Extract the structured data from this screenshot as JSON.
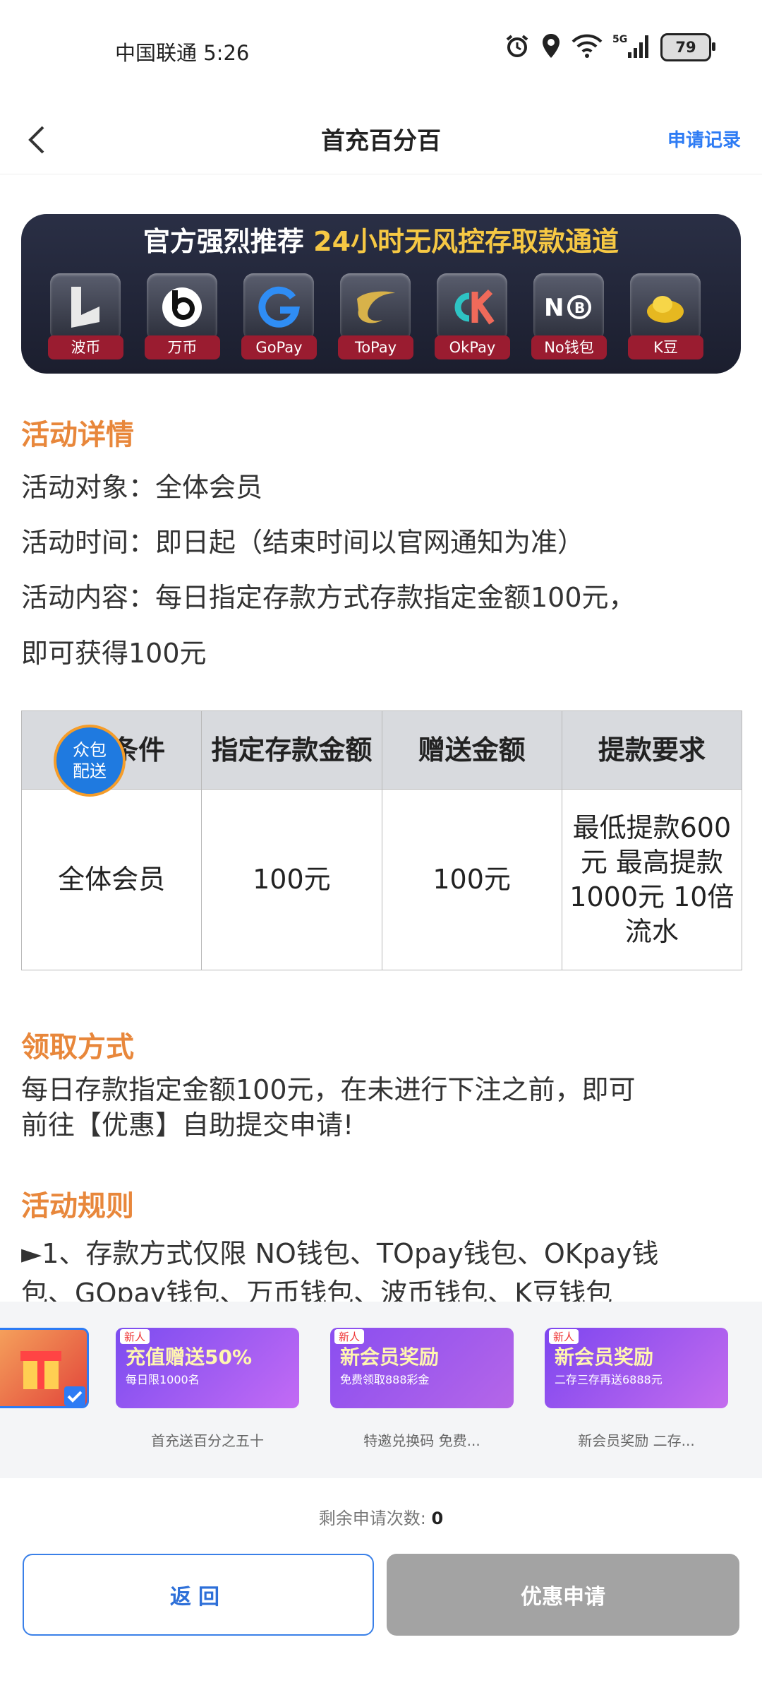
{
  "status_bar": {
    "carrier_time": "中国联通 5:26",
    "battery": "79",
    "network": "5G"
  },
  "header": {
    "title": "首充百分百",
    "record_link": "申请记录"
  },
  "banner": {
    "title_white": "官方强烈推荐",
    "title_yellow": "24小时无风控存取款通道",
    "payments": [
      {
        "label": "波币",
        "icon": "bobi-icon"
      },
      {
        "label": "万币",
        "icon": "wanbi-icon"
      },
      {
        "label": "GoPay",
        "icon": "gopay-icon"
      },
      {
        "label": "ToPay",
        "icon": "topay-icon"
      },
      {
        "label": "OkPay",
        "icon": "okpay-icon"
      },
      {
        "label": "No钱包",
        "icon": "nowallet-icon"
      },
      {
        "label": "K豆",
        "icon": "kdou-icon"
      }
    ]
  },
  "details": {
    "title": "活动详情",
    "target": "活动对象：全体会员",
    "time": "活动时间：即日起（结束时间以官网通知为准）",
    "content_line1": "活动内容：每日指定存款方式存款指定金额100元，",
    "content_line2": "即可获得100元"
  },
  "table": {
    "headers": [
      "参与条件",
      "指定存款金额",
      "赠送金额",
      "提款要求"
    ],
    "row": [
      "全体会员",
      "100元",
      "100元",
      "最低提款600元 最高提款1000元 10倍流水"
    ]
  },
  "float_badge": {
    "line1": "众包",
    "line2": "配送"
  },
  "claim": {
    "title": "领取方式",
    "line1": "每日存款指定金额100元，在未进行下注之前，即可",
    "line2": "前往【优惠】自助提交申请!"
  },
  "rules": {
    "title": "活动规则",
    "line1": "►1、存款方式仅限 NO钱包、TOpay钱包、OKpay钱",
    "line2": "包、GOpay钱包、万币钱包、波币钱包、K豆钱包"
  },
  "carousel": [
    {
      "caption": "首充送百分之五十",
      "tag": "新人",
      "headline": "充值赠送50%",
      "sub": "每日限1000名"
    },
    {
      "caption": "特邀兑换码 免费...",
      "tag": "新人",
      "headline": "新会员奖励",
      "sub": "免费领取888彩金"
    },
    {
      "caption": "新会员奖励 二存...",
      "tag": "新人",
      "headline": "新会员奖励",
      "sub": "二存三存再送6888元"
    }
  ],
  "bottom": {
    "remain_label": "剩余申请次数:",
    "remain_count": "0",
    "back_button": "返回",
    "apply_button": "优惠申请"
  },
  "colors": {
    "accent_orange": "#e8873b",
    "link_blue": "#2d7bf4",
    "disabled_gray": "#a3a3a3"
  }
}
